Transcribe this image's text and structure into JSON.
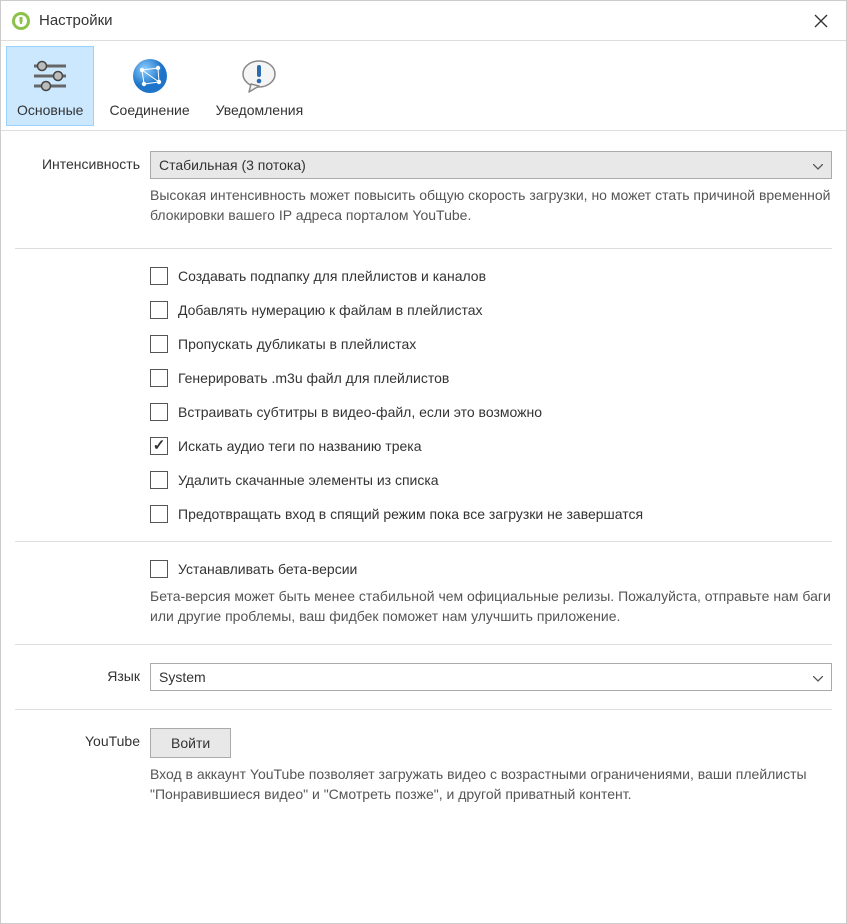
{
  "window": {
    "title": "Настройки"
  },
  "tabs": {
    "general": "Основные",
    "connection": "Соединение",
    "notifications": "Уведомления"
  },
  "intensity": {
    "label": "Интенсивность",
    "value": "Стабильная (3 потока)",
    "help": "Высокая интенсивность может повысить общую скорость загрузки, но может стать причиной временной блокировки вашего IP адреса порталом YouTube."
  },
  "options": {
    "subfolder": {
      "label": "Создавать подпапку для плейлистов и каналов",
      "checked": false
    },
    "numbering": {
      "label": "Добавлять нумерацию к файлам в плейлистах",
      "checked": false
    },
    "skip_dupes": {
      "label": "Пропускать дубликаты в плейлистах",
      "checked": false
    },
    "m3u": {
      "label": "Генерировать .m3u файл для плейлистов",
      "checked": false
    },
    "embed_subs": {
      "label": "Встраивать субтитры в видео-файл, если это возможно",
      "checked": false
    },
    "audio_tags": {
      "label": "Искать аудио теги по названию трека",
      "checked": true
    },
    "remove_done": {
      "label": "Удалить скачанные элементы из списка",
      "checked": false
    },
    "prevent_sleep": {
      "label": "Предотвращать вход в спящий режим пока все загрузки не завершатся",
      "checked": false
    }
  },
  "beta": {
    "label": "Устанавливать бета-версии",
    "checked": false,
    "help": "Бета-версия может быть менее стабильной чем официальные релизы.  Пожалуйста, отправьте нам баги или другие проблемы, ваш фидбек поможет нам улучшить приложение."
  },
  "language": {
    "label": "Язык",
    "value": "System"
  },
  "youtube": {
    "label": "YouTube",
    "button": "Войти",
    "help": "Вход в аккаунт YouTube позволяет загружать видео с возрастными ограничениями, ваши плейлисты \"Понравившиеся видео\" и \"Смотреть позже\", и другой приватный контент."
  }
}
